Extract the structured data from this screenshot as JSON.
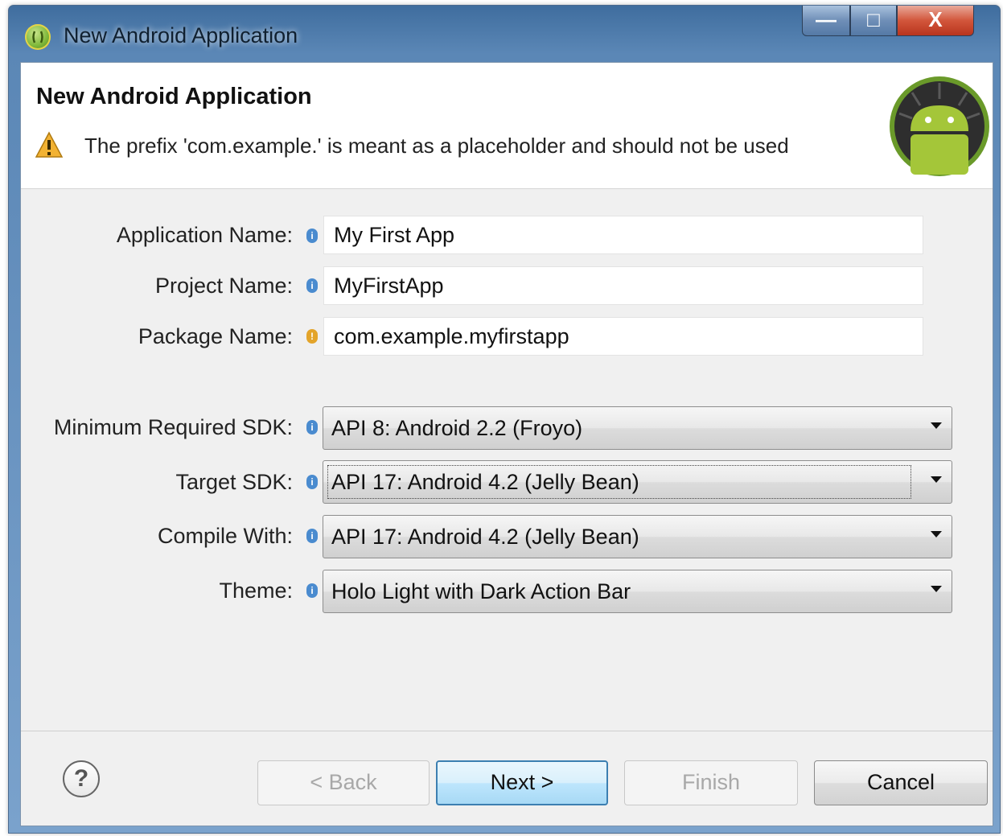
{
  "window": {
    "title": "New Android Application",
    "controls": {
      "minimize": "—",
      "maximize": "□",
      "close": "X"
    }
  },
  "header": {
    "title": "New Android Application",
    "warning": "The prefix 'com.example.' is meant as a placeholder and should not be used"
  },
  "form": {
    "application_name": {
      "label": "Application Name:",
      "value": "My First App",
      "icon": "info-icon"
    },
    "project_name": {
      "label": "Project Name:",
      "value": "MyFirstApp",
      "icon": "info-icon"
    },
    "package_name": {
      "label": "Package Name:",
      "value": "com.example.myfirstapp",
      "icon": "warning-icon"
    },
    "min_sdk": {
      "label": "Minimum Required SDK:",
      "value": "API 8: Android 2.2 (Froyo)",
      "icon": "info-icon"
    },
    "target_sdk": {
      "label": "Target SDK:",
      "value": "API 17: Android 4.2 (Jelly Bean)",
      "icon": "info-icon"
    },
    "compile_with": {
      "label": "Compile With:",
      "value": "API 17: Android 4.2 (Jelly Bean)",
      "icon": "info-icon"
    },
    "theme": {
      "label": "Theme:",
      "value": "Holo Light with Dark Action Bar",
      "icon": "info-icon"
    }
  },
  "footer": {
    "help": "?",
    "back": "< Back",
    "next": "Next >",
    "finish": "Finish",
    "cancel": "Cancel"
  },
  "colors": {
    "titlebar": "#5b87b6",
    "default_button": "#3c7fb1",
    "android_green": "#7fb83a",
    "info_icon": "#4a8bcf",
    "warning_icon": "#e3a42a"
  }
}
